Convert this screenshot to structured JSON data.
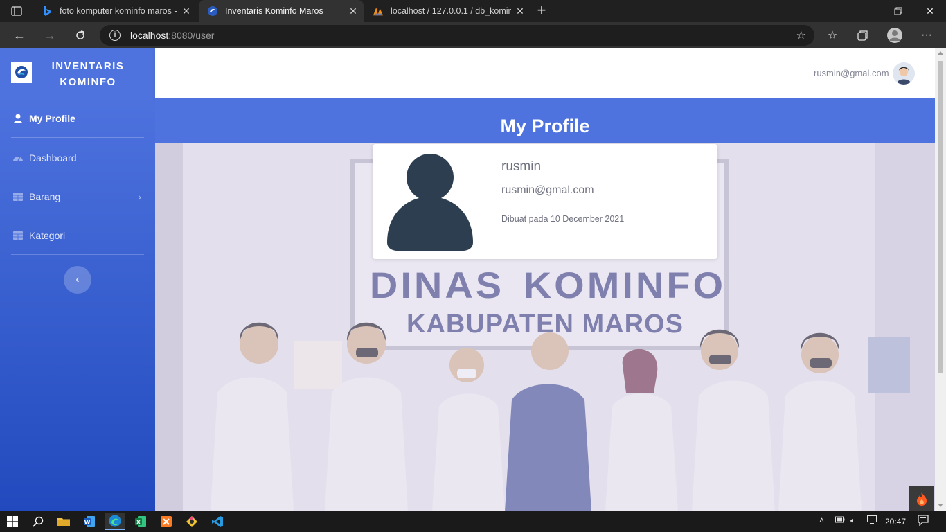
{
  "browser": {
    "tabs": [
      {
        "title": "foto komputer kominfo maros - ",
        "icon": "bing-icon"
      },
      {
        "title": "Inventaris Kominfo Maros",
        "icon": "app-favicon"
      },
      {
        "title": "localhost / 127.0.0.1 / db_kominf",
        "icon": "phpmyadmin-icon"
      }
    ],
    "url_host": "localhost",
    "url_path": ":8080/user"
  },
  "sidebar": {
    "brand_line1": "INVENTARIS",
    "brand_line2": "KOMINFO",
    "items": [
      {
        "label": "My Profile",
        "icon": "user-icon"
      },
      {
        "label": "Dashboard",
        "icon": "tachometer-icon"
      },
      {
        "label": "Barang",
        "icon": "table-icon"
      },
      {
        "label": "Kategori",
        "icon": "table-icon"
      }
    ],
    "toggle_symbol": "‹"
  },
  "topbar": {
    "user_email": "rusmin@gmal.com"
  },
  "page": {
    "title": "My Profile",
    "profile": {
      "name": "rusmin",
      "email": "rusmin@gmal.com",
      "created": "Dibuat pada 10 December 2021"
    },
    "photo_sign_line1": "DINAS",
    "photo_sign_line1b": "KOMINFO",
    "photo_sign_line2": "KABUPATEN MAROS"
  },
  "taskbar": {
    "time": "20:47"
  },
  "colors": {
    "primary": "#4e73df",
    "sidebar_gradient_end": "#224abe",
    "text_muted": "#858796",
    "avatar_fill": "#2c3e50"
  }
}
